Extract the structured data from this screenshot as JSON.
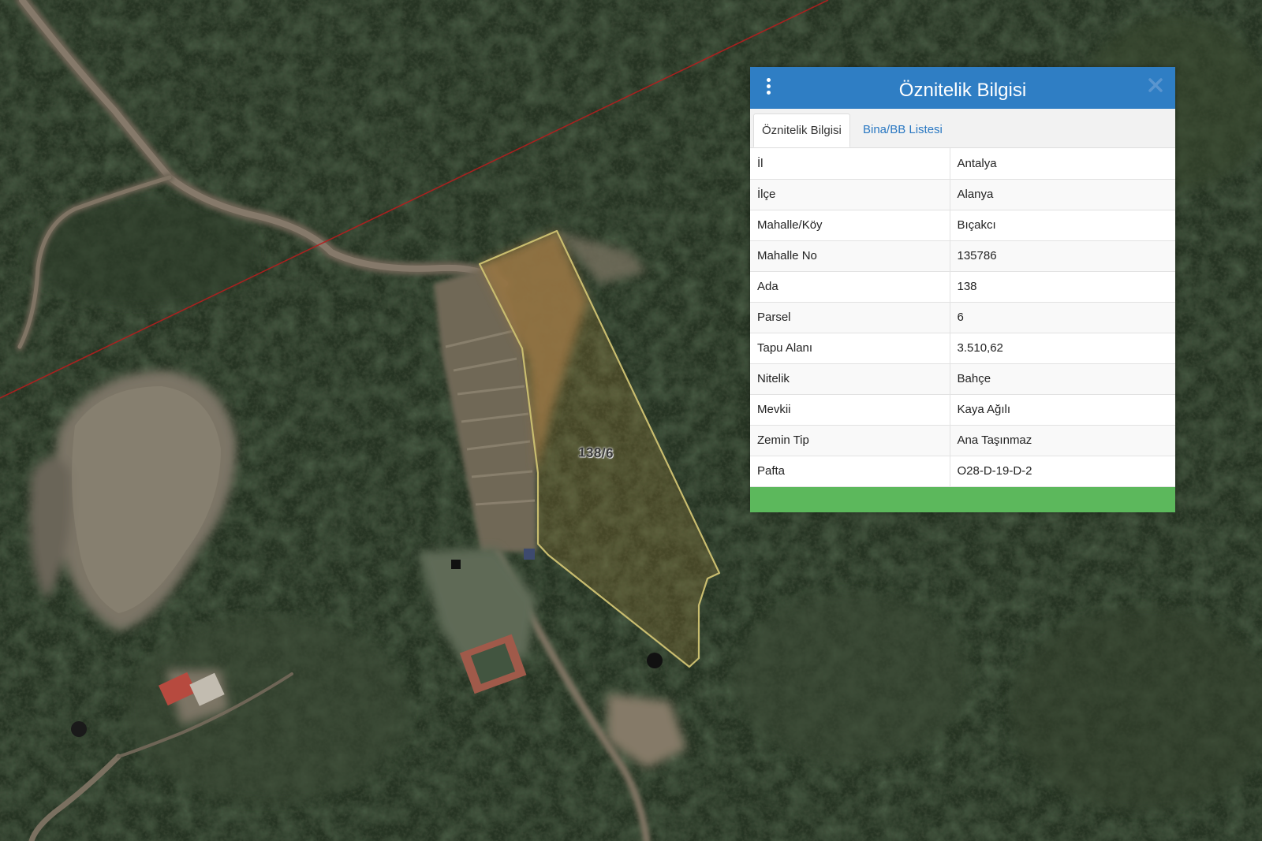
{
  "map": {
    "parcel_label": "138/6",
    "colors": {
      "forest": "#1f2a1c",
      "parcel_outline": "#c9bd6f",
      "boundary_line": "#b41e1e"
    }
  },
  "popup": {
    "title": "Öznitelik Bilgisi",
    "tabs": [
      {
        "label": "Öznitelik Bilgisi",
        "active": true
      },
      {
        "label": "Bina/BB Listesi",
        "active": false
      }
    ],
    "rows": [
      {
        "key": "İl",
        "value": "Antalya"
      },
      {
        "key": "İlçe",
        "value": "Alanya"
      },
      {
        "key": "Mahalle/Köy",
        "value": "Bıçakcı"
      },
      {
        "key": "Mahalle No",
        "value": "135786"
      },
      {
        "key": "Ada",
        "value": "138"
      },
      {
        "key": "Parsel",
        "value": "6"
      },
      {
        "key": "Tapu Alanı",
        "value": "3.510,62"
      },
      {
        "key": "Nitelik",
        "value": "Bahçe"
      },
      {
        "key": "Mevkii",
        "value": "Kaya Ağılı"
      },
      {
        "key": "Zemin Tip",
        "value": "Ana Taşınmaz"
      },
      {
        "key": "Pafta",
        "value": "O28-D-19-D-2"
      }
    ],
    "colors": {
      "header": "#2f7ec4",
      "footer": "#5cb85c",
      "tab_link": "#2a78c2"
    },
    "icons": {
      "menu": "vertical-dots-icon",
      "close": "close-icon"
    }
  }
}
